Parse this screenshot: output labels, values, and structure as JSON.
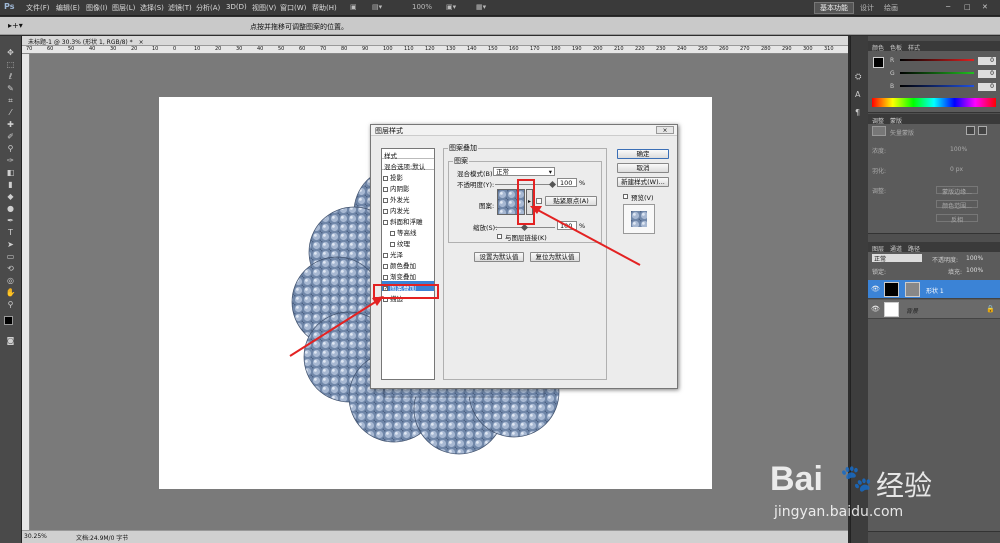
{
  "app": {
    "logo": "Ps",
    "workspace_label": "基本功能",
    "top_right_links": [
      "设计",
      "绘画"
    ]
  },
  "menu": [
    "文件(F)",
    "编辑(E)",
    "图像(I)",
    "图层(L)",
    "选择(S)",
    "滤镜(T)",
    "分析(A)",
    "3D(D)",
    "视图(V)",
    "窗口(W)",
    "帮助(H)"
  ],
  "zoom_label": "100%",
  "options_hint": "点按并拖移可调整图案的位置。",
  "document_tab": "未标题-1 @ 30.3% (形状 1, RGB/8) *",
  "ruler_ticks": [
    "70",
    "60",
    "50",
    "40",
    "30",
    "20",
    "10",
    "0",
    "10",
    "20",
    "30",
    "40",
    "50",
    "60",
    "70",
    "80",
    "90",
    "100",
    "110",
    "120",
    "130",
    "140",
    "150",
    "160",
    "170",
    "180",
    "190",
    "200",
    "210",
    "220",
    "230",
    "240",
    "250",
    "260",
    "270",
    "280",
    "290",
    "300",
    "310"
  ],
  "status": {
    "zoom": "30.25%",
    "doc": "文档:24.9M/0 字节"
  },
  "dialog": {
    "title": "图层样式",
    "close": "⨯",
    "styles_header": "样式",
    "blend_options": "混合选项:默认",
    "items": [
      {
        "label": "投影",
        "checked": false
      },
      {
        "label": "内阴影",
        "checked": false
      },
      {
        "label": "外发光",
        "checked": false
      },
      {
        "label": "内发光",
        "checked": false
      },
      {
        "label": "斜面和浮雕",
        "checked": false
      },
      {
        "label": "等高线",
        "checked": false,
        "indent": true
      },
      {
        "label": "纹理",
        "checked": false,
        "indent": true
      },
      {
        "label": "光泽",
        "checked": false
      },
      {
        "label": "颜色叠加",
        "checked": false
      },
      {
        "label": "渐变叠加",
        "checked": false
      },
      {
        "label": "图案叠加",
        "checked": true,
        "selected": true
      },
      {
        "label": "描边",
        "checked": false
      }
    ],
    "section_title": "图案叠加",
    "group_title": "图案",
    "blend_mode_label": "混合模式(B):",
    "blend_mode_value": "正常",
    "opacity_label": "不透明度(Y):",
    "opacity_value": "100",
    "percent": "%",
    "pattern_label": "图案:",
    "snap_origin": "贴紧原点(A)",
    "scale_label": "缩放(S):",
    "scale_value": "100",
    "link_label": "与图层链接(K)",
    "set_default": "设置为默认值",
    "reset_default": "复位为默认值",
    "ok": "确定",
    "cancel": "取消",
    "new_style": "新建样式(W)...",
    "preview": "预览(V)"
  },
  "panels": {
    "color_tabs": [
      "颜色",
      "色板",
      "样式"
    ],
    "rgb": [
      {
        "label": "R",
        "value": "0"
      },
      {
        "label": "G",
        "value": "0"
      },
      {
        "label": "B",
        "value": "0"
      }
    ],
    "adjust_tabs": [
      "调整",
      "蒙版"
    ],
    "mask_label": "矢量蒙版",
    "density_label": "浓度:",
    "density_value": "100%",
    "feather_label": "羽化:",
    "feather_value": "0 px",
    "refine_label": "调整:",
    "mask_buttons": [
      "蒙版边缘...",
      "颜色范围...",
      "反相"
    ],
    "layers_tabs": [
      "图层",
      "通道",
      "路径"
    ],
    "blend": "正常",
    "opacity_label": "不透明度:",
    "opacity_value": "100%",
    "lock_label": "锁定:",
    "fill_label": "填充:",
    "fill_value": "100%",
    "layers": [
      {
        "name": "形状 1",
        "selected": true
      },
      {
        "name": "背景",
        "selected": false
      }
    ]
  },
  "watermark": {
    "brand": "Bai",
    "brand2": "经验",
    "url": "jingyan.baidu.com"
  },
  "colors": {
    "selection": "#3b83d6",
    "annotation": "#e32222",
    "pattern": "#7d92b2"
  }
}
